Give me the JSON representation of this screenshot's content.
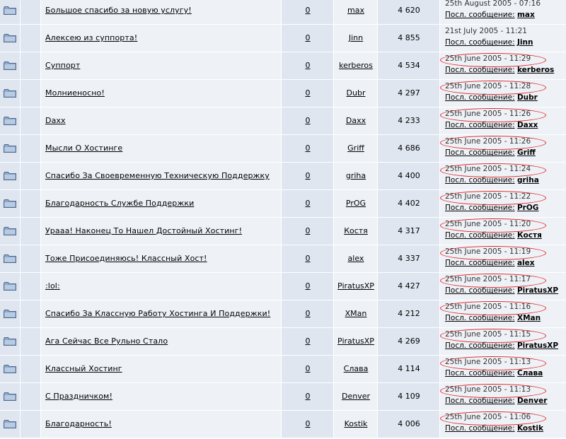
{
  "labels": {
    "last_post_label": "Посл. сообщение:"
  },
  "colors": {
    "row_dark": "#dfe6ef",
    "row_light": "#eef2f7",
    "annotation_red": "#e02020"
  },
  "topics": [
    {
      "title": "Большое спасибо за новую услугу!",
      "replies": "0",
      "author": "max",
      "views": "4 620",
      "last_date": "25th August 2005 - 07:16",
      "last_user": "max",
      "circled": false
    },
    {
      "title": "Алексею из суппорта!",
      "replies": "0",
      "author": "Jinn",
      "views": "4 855",
      "last_date": "21st July 2005 - 11:21",
      "last_user": "Jinn",
      "circled": false
    },
    {
      "title": "Суппорт",
      "replies": "0",
      "author": "kerberos",
      "views": "4 534",
      "last_date": "25th June 2005 - 11:29",
      "last_user": "kerberos",
      "circled": true
    },
    {
      "title": "Молниеносно!",
      "replies": "0",
      "author": "Dubr",
      "views": "4 297",
      "last_date": "25th June 2005 - 11:28",
      "last_user": "Dubr",
      "circled": true
    },
    {
      "title": "Daxx",
      "replies": "0",
      "author": "Daxx",
      "views": "4 233",
      "last_date": "25th June 2005 - 11:26",
      "last_user": "Daxx",
      "circled": true
    },
    {
      "title": "Мысли О Хостинге",
      "replies": "0",
      "author": "Griff",
      "views": "4 686",
      "last_date": "25th June 2005 - 11:26",
      "last_user": "Griff",
      "circled": true
    },
    {
      "title": "Спасибо За Своевременную Техническую Поддержку",
      "replies": "0",
      "author": "griha",
      "views": "4 400",
      "last_date": "25th June 2005 - 11:24",
      "last_user": "griha",
      "circled": true
    },
    {
      "title": "Благодарность Службе Поддержки",
      "replies": "0",
      "author": "PrOG",
      "views": "4 402",
      "last_date": "25th June 2005 - 11:22",
      "last_user": "PrOG",
      "circled": true
    },
    {
      "title": "Урааа! Наконец То Нашел Достойный Хостинг!",
      "replies": "0",
      "author": "Костя",
      "views": "4 317",
      "last_date": "25th June 2005 - 11:20",
      "last_user": "Костя",
      "circled": true
    },
    {
      "title": "Тоже Присоединяюсь! Классный Хост!",
      "replies": "0",
      "author": "alex",
      "views": "4 337",
      "last_date": "25th June 2005 - 11:19",
      "last_user": "alex",
      "circled": true
    },
    {
      "title": ":lol:",
      "replies": "0",
      "author": "PiratusXP",
      "views": "4 427",
      "last_date": "25th June 2005 - 11:17",
      "last_user": "PiratusXP",
      "circled": true
    },
    {
      "title": "Спасибо За Классную Работу Хостинга И Поддержки!",
      "replies": "0",
      "author": "XMan",
      "views": "4 212",
      "last_date": "25th June 2005 - 11:16",
      "last_user": "XMan",
      "circled": true
    },
    {
      "title": "Ага Сейчас Все Рульно Стало",
      "replies": "0",
      "author": "PiratusXP",
      "views": "4 269",
      "last_date": "25th June 2005 - 11:15",
      "last_user": "PiratusXP",
      "circled": true
    },
    {
      "title": "Классный Хостинг",
      "replies": "0",
      "author": "Слава",
      "views": "4 114",
      "last_date": "25th June 2005 - 11:13",
      "last_user": "Слава",
      "circled": true
    },
    {
      "title": "С Праздничком!",
      "replies": "0",
      "author": "Denver",
      "views": "4 109",
      "last_date": "25th June 2005 - 11:13",
      "last_user": "Denver",
      "circled": true
    },
    {
      "title": "Благодарность!",
      "replies": "0",
      "author": "Kostik",
      "views": "4 006",
      "last_date": "25th June 2005 - 11:06",
      "last_user": "Kostik",
      "circled": true
    }
  ]
}
